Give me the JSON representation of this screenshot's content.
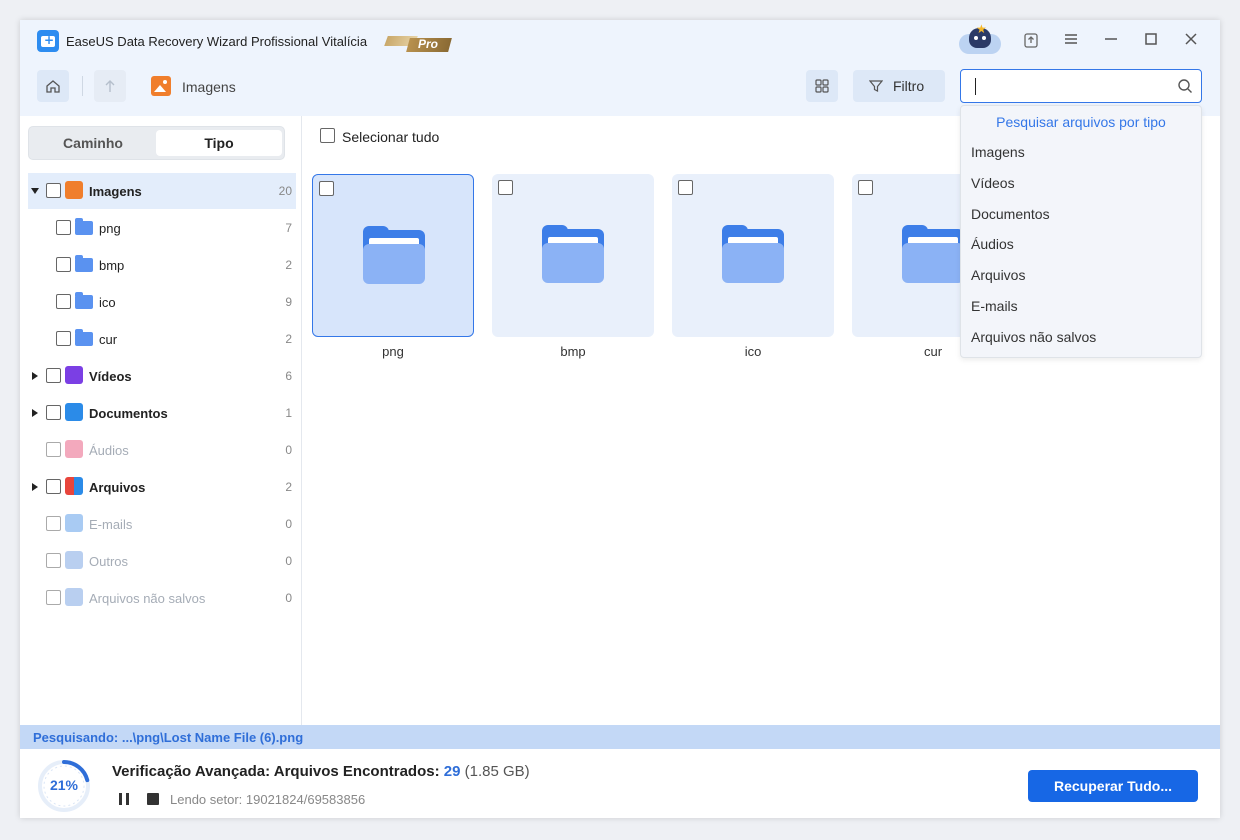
{
  "app": {
    "title": "EaseUS Data Recovery Wizard Profissional Vitalícia",
    "badge": "Pro"
  },
  "toolbar": {
    "breadcrumb": "Imagens",
    "filter_label": "Filtro",
    "search_value": ""
  },
  "sidebar": {
    "tabs": [
      "Caminho",
      "Tipo"
    ],
    "active_tab": "Tipo",
    "tree": [
      {
        "label": "Imagens",
        "count": "20",
        "expanded": true,
        "icon": "image-icon"
      },
      {
        "label": "png",
        "count": "7",
        "icon": "folder-icon"
      },
      {
        "label": "bmp",
        "count": "2",
        "icon": "folder-icon"
      },
      {
        "label": "ico",
        "count": "9",
        "icon": "folder-icon"
      },
      {
        "label": "cur",
        "count": "2",
        "icon": "folder-icon"
      },
      {
        "label": "Vídeos",
        "count": "6",
        "icon": "video-icon"
      },
      {
        "label": "Documentos",
        "count": "1",
        "icon": "document-icon"
      },
      {
        "label": "Áudios",
        "count": "0",
        "icon": "audio-icon"
      },
      {
        "label": "Arquivos",
        "count": "2",
        "icon": "archive-icon"
      },
      {
        "label": "E-mails",
        "count": "0",
        "icon": "email-icon"
      },
      {
        "label": "Outros",
        "count": "0",
        "icon": "other-icon"
      },
      {
        "label": "Arquivos não salvos",
        "count": "0",
        "icon": "unsaved-icon"
      }
    ]
  },
  "main": {
    "select_all": "Selecionar tudo",
    "folders": [
      "png",
      "bmp",
      "ico",
      "cur"
    ]
  },
  "search_dropdown": {
    "header": "Pesquisar arquivos por tipo",
    "items": [
      "Imagens",
      "Vídeos",
      "Documentos",
      "Áudios",
      "Arquivos",
      "E-mails",
      "Arquivos não salvos"
    ]
  },
  "status": {
    "searching": "Pesquisando: ...\\png\\Lost Name File (6).png"
  },
  "footer": {
    "progress": "21%",
    "progress_fraction": 0.21,
    "title": "Verificação Avançada: Arquivos Encontrados:",
    "found_count": "29",
    "found_size": "(1.85 GB)",
    "sector": "Lendo setor: 19021824/69583856",
    "recover_label": "Recuperar Tudo..."
  },
  "colors": {
    "accent": "#1767e5",
    "selected_bg": "#e3edfb",
    "status_strip": "#c3d8f6"
  }
}
